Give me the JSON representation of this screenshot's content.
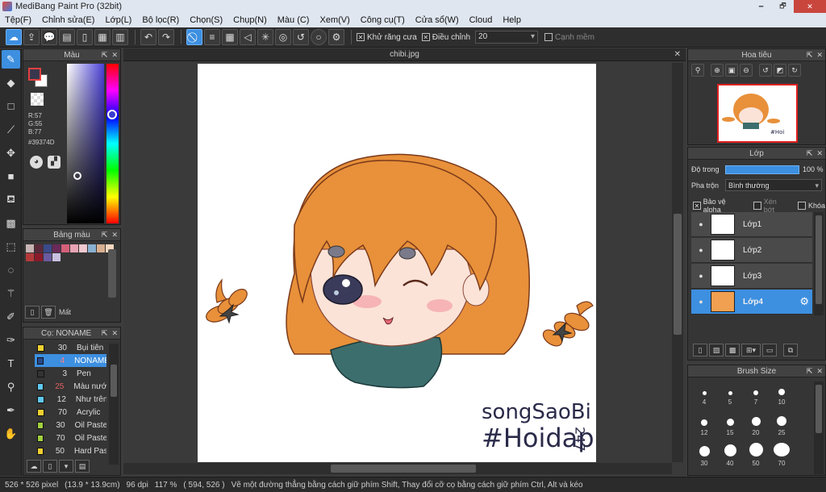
{
  "window": {
    "title": "MediBang Paint Pro (32bit)",
    "minimize": "🗕",
    "maximize": "🗗",
    "close": "✕"
  },
  "menu": [
    "Tệp(F)",
    "Chỉnh sửa(E)",
    "Lớp(L)",
    "Bộ lọc(R)",
    "Chọn(S)",
    "Chụp(N)",
    "Màu (C)",
    "Xem(V)",
    "Công cụ(T)",
    "Cửa sổ(W)",
    "Cloud",
    "Help"
  ],
  "toolbar": {
    "antialias_label": "Khử răng cưa",
    "correction_label": "Điều chỉnh",
    "correction_value": "20",
    "crisp_label": "Cạnh mềm",
    "check": "✕"
  },
  "color_panel": {
    "title": "Màu",
    "rgb_r": "R:57",
    "rgb_g": "G:55",
    "rgb_b": "B:77",
    "hex": "#39374D",
    "fg_color": "#39374D",
    "bg_color": "#FFFFFF"
  },
  "palette_panel": {
    "title": "Bảng màu",
    "delete_label": "Mất",
    "colors": [
      "#c8b4b4",
      "#5a2a3a",
      "#3a4a8a",
      "#6a2a5a",
      "#d4607a",
      "#e8a4b4",
      "#f0c8d0",
      "#8ab0d0",
      "#d8b090",
      "#f8d8c0",
      "#b43a3a",
      "#8a1a2a",
      "#6a5aa0",
      "#c8c0e0"
    ]
  },
  "brush_panel": {
    "title": "Cọ: NONAME",
    "brushes": [
      {
        "size": "30",
        "name": "Bụi tiên",
        "color": "#f0d030"
      },
      {
        "size": "4",
        "name": "NONAME",
        "color": "#2a4a8a"
      },
      {
        "size": "3",
        "name": "Pen",
        "color": "#333333"
      },
      {
        "size": "25",
        "name": "Màu nước",
        "color": "#60c8f0"
      },
      {
        "size": "12",
        "name": "Như trên",
        "color": "#60c8f0"
      },
      {
        "size": "70",
        "name": "Acrylic",
        "color": "#f0d030"
      },
      {
        "size": "30",
        "name": "Oil Pastel",
        "color": "#a0d040"
      },
      {
        "size": "70",
        "name": "Oil Pastel",
        "color": "#a0d040"
      },
      {
        "size": "50",
        "name": "Hard Past",
        "color": "#f0d030"
      }
    ]
  },
  "document": {
    "tab": "chibi.jpg",
    "close": "✕",
    "signature": "songSaoBi",
    "hashtag": "#Hoidap",
    "numbers": "247"
  },
  "navigator_panel": {
    "title": "Hoa tiêu"
  },
  "layer_panel": {
    "title": "Lớp",
    "opacity_label": "Độ trong",
    "opacity_value": "100 %",
    "blend_label": "Pha trộn",
    "blend_value": "Bình thường",
    "protect_alpha": "Bảo vệ alpha",
    "clip": "Xén bớt",
    "lock": "Khóa",
    "layers": [
      "Lớp1",
      "Lớp2",
      "Lớp3",
      "Lớp4"
    ]
  },
  "brushsize_panel": {
    "title": "Brush Size",
    "sizes": [
      "4",
      "5",
      "7",
      "10",
      "12",
      "15",
      "20",
      "25",
      "30",
      "40",
      "50",
      "70"
    ]
  },
  "status": {
    "size": "526 * 526 pixel",
    "physical": "(13.9 * 13.9cm)",
    "dpi": "96 dpi",
    "zoom": "117 %",
    "coords": "( 594, 526 )",
    "hint": "Vẽ một đường thẳng bằng cách giữ phím Shift, Thay đổi cỡ cọ bằng cách giữ phím Ctrl, Alt và kéo"
  },
  "colors": {
    "accent": "#3d8fe0",
    "hair": "#e8903a",
    "scarf": "#3d6e6e"
  }
}
